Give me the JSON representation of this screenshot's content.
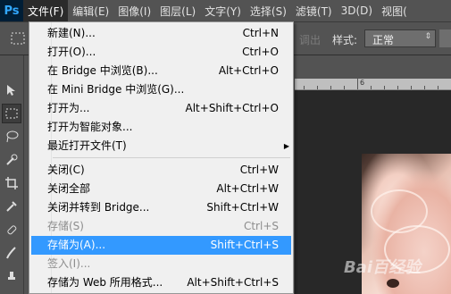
{
  "menubar": {
    "logo": "Ps",
    "items": [
      "文件(F)",
      "编辑(E)",
      "图像(I)",
      "图层(L)",
      "文字(Y)",
      "选择(S)",
      "滤镜(T)",
      "3D(D)",
      "视图("
    ]
  },
  "options": {
    "ghost_label": "调出",
    "style_label": "样式:",
    "style_value": "正常"
  },
  "ruler": {
    "numbers": [
      "6"
    ]
  },
  "watermark": "Bai百经验",
  "file_menu": {
    "items": [
      {
        "label": "新建(N)...",
        "shortcut": "Ctrl+N",
        "disabled": false
      },
      {
        "label": "打开(O)...",
        "shortcut": "Ctrl+O",
        "disabled": false
      },
      {
        "label": "在 Bridge 中浏览(B)...",
        "shortcut": "Alt+Ctrl+O",
        "disabled": false
      },
      {
        "label": "在 Mini Bridge 中浏览(G)...",
        "shortcut": "",
        "disabled": false
      },
      {
        "label": "打开为...",
        "shortcut": "Alt+Shift+Ctrl+O",
        "disabled": false
      },
      {
        "label": "打开为智能对象...",
        "shortcut": "",
        "disabled": false
      },
      {
        "label": "最近打开文件(T)",
        "shortcut": "",
        "disabled": false,
        "submenu": true
      },
      {
        "label": "关闭(C)",
        "shortcut": "Ctrl+W",
        "disabled": false
      },
      {
        "label": "关闭全部",
        "shortcut": "Alt+Ctrl+W",
        "disabled": false
      },
      {
        "label": "关闭并转到 Bridge...",
        "shortcut": "Shift+Ctrl+W",
        "disabled": false
      },
      {
        "label": "存储(S)",
        "shortcut": "Ctrl+S",
        "disabled": true
      },
      {
        "label": "存储为(A)...",
        "shortcut": "Shift+Ctrl+S",
        "disabled": false,
        "highlighted": true
      },
      {
        "label": "签入(I)...",
        "shortcut": "",
        "disabled": true
      },
      {
        "label": "存储为 Web 所用格式...",
        "shortcut": "Alt+Shift+Ctrl+S",
        "disabled": false
      }
    ]
  },
  "colors": {
    "highlight": "#3399ff",
    "menu_bg": "#f0f0f0",
    "app_bg": "#535353"
  }
}
